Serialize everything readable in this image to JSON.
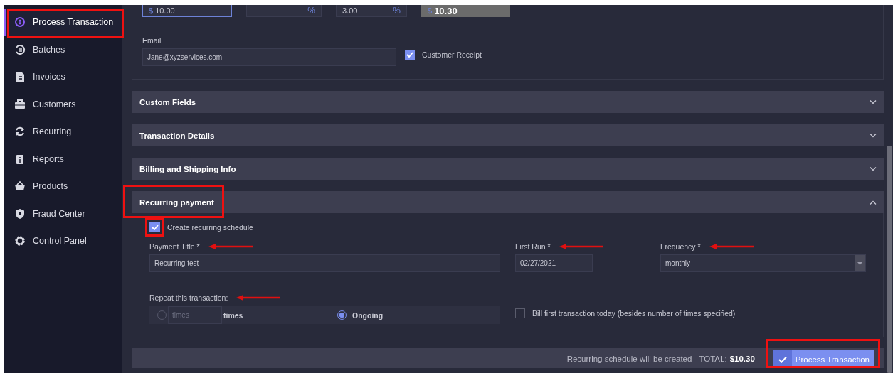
{
  "sidebar": {
    "items": [
      {
        "label": "Process Transaction",
        "selected": true,
        "highlighted": true
      },
      {
        "label": "Batches",
        "selected": false,
        "highlighted": false
      },
      {
        "label": "Invoices",
        "selected": false,
        "highlighted": false
      },
      {
        "label": "Customers",
        "selected": false,
        "highlighted": false
      },
      {
        "label": "Recurring",
        "selected": false,
        "highlighted": false
      },
      {
        "label": "Reports",
        "selected": false,
        "highlighted": false
      },
      {
        "label": "Products",
        "selected": false,
        "highlighted": false
      },
      {
        "label": "Fraud Center",
        "selected": false,
        "highlighted": false
      },
      {
        "label": "Control Panel",
        "selected": false,
        "highlighted": false
      }
    ]
  },
  "payment_row": {
    "fields": [
      {
        "kind": "amount",
        "prefix": "$",
        "value": "10.00",
        "focused": true
      },
      {
        "kind": "percent",
        "suffix": "%",
        "focused": false
      },
      {
        "kind": "percent",
        "value": "3.00",
        "suffix": "%",
        "focused": false
      },
      {
        "kind": "total",
        "prefix": "$",
        "value": "10.30",
        "focused": false
      }
    ]
  },
  "email": {
    "label": "Email",
    "value": "Jane@xyzservices.com"
  },
  "customer_receipt": {
    "label": "Customer Receipt",
    "checked": true
  },
  "sections": [
    {
      "title": "Custom Fields",
      "expanded": false,
      "highlighted": false
    },
    {
      "title": "Transaction Details",
      "expanded": false,
      "highlighted": false
    },
    {
      "title": "Billing and Shipping Info",
      "expanded": false,
      "highlighted": false
    },
    {
      "title": "Recurring payment",
      "expanded": true,
      "highlighted": true
    }
  ],
  "recurring": {
    "create_schedule": {
      "label": "Create recurring schedule",
      "checked": true,
      "highlighted": true
    },
    "payment_title": {
      "label": "Payment Title *",
      "value": "Recurring test",
      "arrow": true
    },
    "first_run": {
      "label": "First Run *",
      "value": "02/27/2021",
      "arrow": true
    },
    "frequency": {
      "label": "Frequency *",
      "value": "monthly",
      "arrow": true
    },
    "repeat": {
      "label": "Repeat this transaction:",
      "arrow": true,
      "options": [
        {
          "kind": "count",
          "selected": false,
          "placeholder": "times",
          "label": "times"
        },
        {
          "kind": "ongoing",
          "selected": true,
          "label": "Ongoing"
        }
      ]
    },
    "bill_first": {
      "label": "Bill first transaction today (besides number of times specified)",
      "checked": false
    }
  },
  "footer": {
    "note": "Recurring schedule will be created",
    "total_label": "TOTAL:",
    "total_value": "$10.30",
    "button": {
      "label": "Process Transaction",
      "highlighted": true
    }
  }
}
